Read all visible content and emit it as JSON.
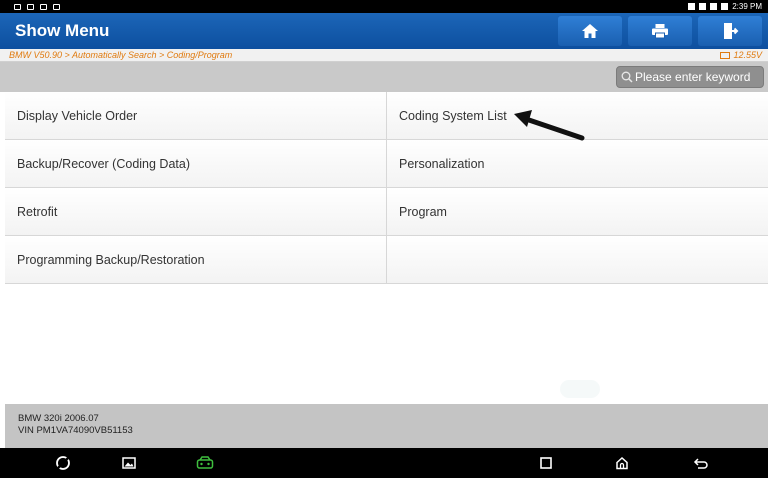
{
  "header": {
    "title": "Show Menu"
  },
  "breadcrumb": {
    "path": "BMW V50.90 > Automatically Search > Coding/Program",
    "voltage": "12.55V"
  },
  "search": {
    "placeholder": "Please enter keyword"
  },
  "status": {
    "time": "2:39 PM"
  },
  "menu": {
    "rows": [
      [
        "Display Vehicle Order",
        "Coding System List"
      ],
      [
        "Backup/Recover (Coding Data)",
        "Personalization"
      ],
      [
        "Retrofit",
        "Program"
      ],
      [
        "Programming Backup/Restoration",
        ""
      ]
    ]
  },
  "vehicle": {
    "model": "BMW 320i 2006.07",
    "vin": "VIN PM1VA74090VB51153"
  },
  "colors": {
    "header_blue": "#0d4f9f",
    "breadcrumb_orange": "#e07b10",
    "diag_green": "#3fbf3f"
  },
  "icons": {
    "home": "home-icon",
    "print": "printer-icon",
    "exit": "exit-icon",
    "search": "search-icon",
    "nav_browser": "browser-icon",
    "nav_gallery": "gallery-icon",
    "nav_diag": "vehicle-diagnostic-icon",
    "nav_recent": "recent-apps-icon",
    "nav_home": "android-home-icon",
    "nav_back": "back-icon"
  }
}
